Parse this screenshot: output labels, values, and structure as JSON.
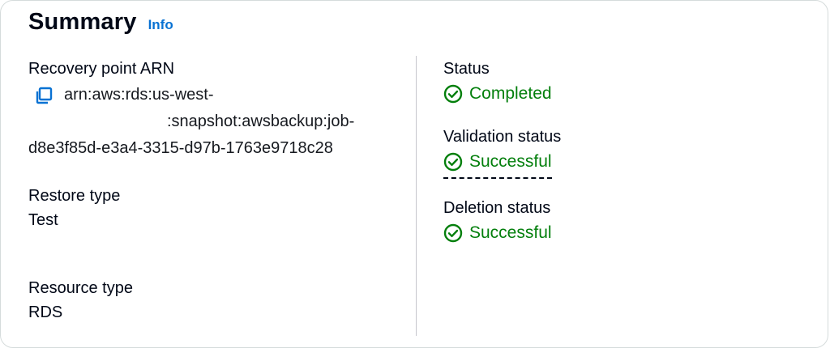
{
  "header": {
    "title": "Summary",
    "info_label": "Info"
  },
  "left": {
    "recovery_point": {
      "label": "Recovery point ARN",
      "arn_line1": "arn:aws:rds:us-west-",
      "arn_line2": ":snapshot:awsbackup:job-",
      "arn_line3": "d8e3f85d-e3a4-3315-d97b-1763e9718c28",
      "copy_icon": "copy-icon"
    },
    "restore_type": {
      "label": "Restore type",
      "value": "Test"
    },
    "resource_type": {
      "label": "Resource type",
      "value": "RDS"
    }
  },
  "right": {
    "status": {
      "label": "Status",
      "value": "Completed",
      "icon": "check-circle-icon"
    },
    "validation_status": {
      "label": "Validation status",
      "value": "Successful",
      "icon": "check-circle-icon"
    },
    "deletion_status": {
      "label": "Deletion status",
      "value": "Successful",
      "icon": "check-circle-icon"
    }
  },
  "colors": {
    "link": "#0972d3",
    "success": "#037f0c",
    "text": "#000716",
    "border": "#d5dbdb"
  }
}
